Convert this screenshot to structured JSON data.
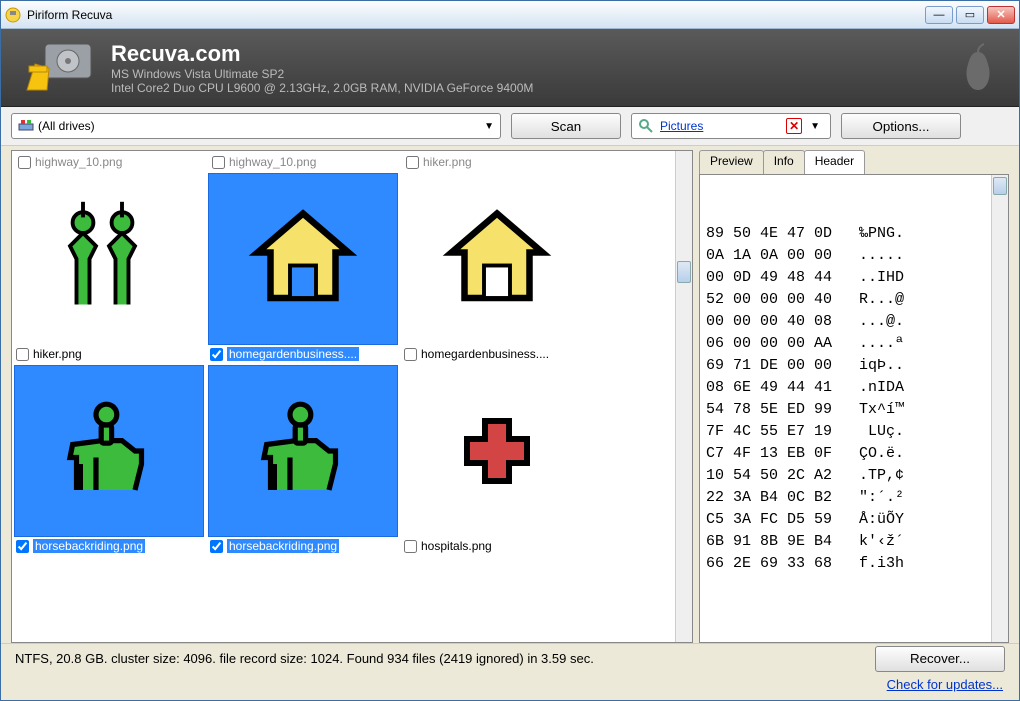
{
  "window": {
    "title": "Piriform Recuva"
  },
  "banner": {
    "brand": "Recuva.com",
    "line1": "MS Windows Vista Ultimate SP2",
    "line2": "Intel Core2 Duo CPU L9600 @ 2.13GHz, 2.0GB RAM, NVIDIA GeForce 9400M"
  },
  "toolbar": {
    "drive": "(All drives)",
    "scan": "Scan",
    "filter": "Pictures",
    "options": "Options..."
  },
  "top_row": {
    "a": "highway_10.png",
    "b": "highway_10.png",
    "c": "hiker.png"
  },
  "files": {
    "r1": [
      {
        "name": "hiker.png",
        "checked": false,
        "selected": false,
        "icon": "hiker"
      },
      {
        "name": "homegardenbusiness....",
        "checked": true,
        "selected": true,
        "icon": "house-y"
      },
      {
        "name": "homegardenbusiness....",
        "checked": false,
        "selected": false,
        "icon": "house-y"
      }
    ],
    "r2": [
      {
        "name": "horsebackriding.png",
        "checked": true,
        "selected": true,
        "icon": "horse"
      },
      {
        "name": "horsebackriding.png",
        "checked": true,
        "selected": true,
        "icon": "horse"
      },
      {
        "name": "hospitals.png",
        "checked": false,
        "selected": false,
        "icon": "cross"
      }
    ]
  },
  "tabs": {
    "preview": "Preview",
    "info": "Info",
    "header": "Header",
    "active": "header"
  },
  "hex": [
    "89 50 4E 47 0D   ‰PNG.",
    "0A 1A 0A 00 00   .....",
    "00 0D 49 48 44   ..IHD",
    "52 00 00 00 40   R...@",
    "00 00 00 40 08   ...@.",
    "06 00 00 00 AA   ....ª",
    "69 71 DE 00 00   iqÞ..",
    "08 6E 49 44 41   .nIDA",
    "54 78 5E ED 99   Tx^í™",
    "7F 4C 55 E7 19    LUç.",
    "C7 4F 13 EB 0F   ÇO.ë.",
    "10 54 50 2C A2   .TP,¢",
    "22 3A B4 0C B2   \":´.²",
    "C5 3A FC D5 59   Å:üÕY",
    "6B 91 8B 9E B4   k'‹ž´",
    "66 2E 69 33 68   f.i3h"
  ],
  "status": "NTFS, 20.8 GB. cluster size: 4096. file record size: 1024. Found 934 files (2419 ignored) in 3.59 sec.",
  "recover": "Recover...",
  "updates_link": "Check for updates..."
}
